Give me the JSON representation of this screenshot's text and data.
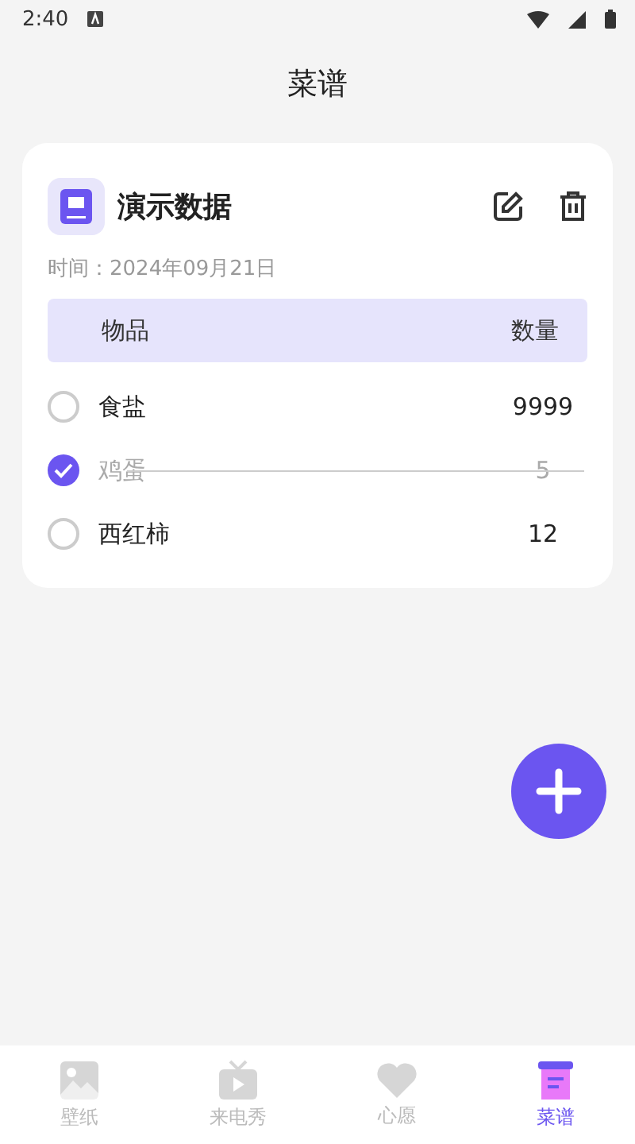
{
  "status_bar": {
    "time": "2:40"
  },
  "header": {
    "title": "菜谱"
  },
  "recipe": {
    "title": "演示数据",
    "date": "时间：2024年09月21日",
    "columns": [
      "物品",
      "数量"
    ],
    "items": [
      {
        "name": "食盐",
        "quantity": "9999",
        "checked": false
      },
      {
        "name": "鸡蛋",
        "quantity": "5",
        "checked": true
      },
      {
        "name": "西红柿",
        "quantity": "12",
        "checked": false
      }
    ]
  },
  "nav": [
    {
      "kind": "wallpaper",
      "label": "壁纸",
      "selected": false
    },
    {
      "kind": "ringtone",
      "label": "来电秀",
      "selected": false
    },
    {
      "kind": "wish",
      "label": "心愿",
      "selected": false
    },
    {
      "kind": "recipe",
      "label": "菜谱",
      "selected": true
    }
  ]
}
